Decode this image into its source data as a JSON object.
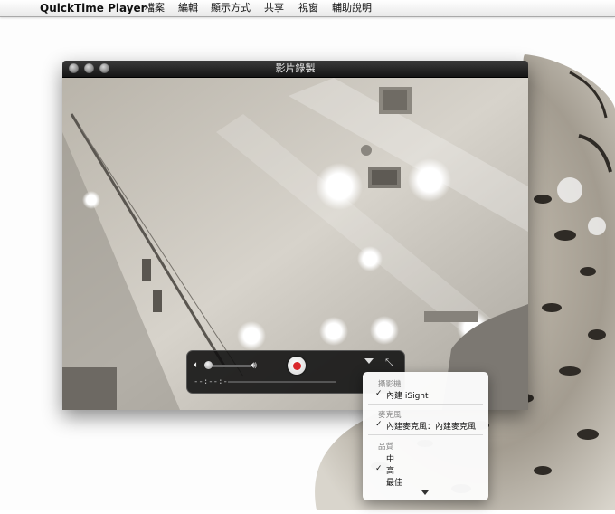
{
  "menubar": {
    "apple": "",
    "app_name": "QuickTime Player",
    "items": [
      "檔案",
      "編輯",
      "顯示方式",
      "共享",
      "視窗",
      "輔助說明"
    ]
  },
  "window": {
    "title": "影片錄製"
  },
  "controller": {
    "time": "--:--:--",
    "volume": 0.0
  },
  "popup_menu": {
    "camera_header": "攝影機",
    "camera_item": "內建 iSight",
    "mic_header": "麥克風",
    "mic_item": "內建麥克風：內建麥克風",
    "quality_header": "品質",
    "quality_items": [
      "中",
      "高",
      "最佳"
    ],
    "checkmark": "✓"
  },
  "colors": {
    "record": "#d9262a",
    "hud": "#0f0f0f"
  },
  "icons": [
    "apple-icon",
    "speaker-low-icon",
    "speaker-high-icon",
    "record-icon",
    "chevron-down-icon",
    "fullscreen-icon",
    "scroll-down-arrow-icon"
  ]
}
